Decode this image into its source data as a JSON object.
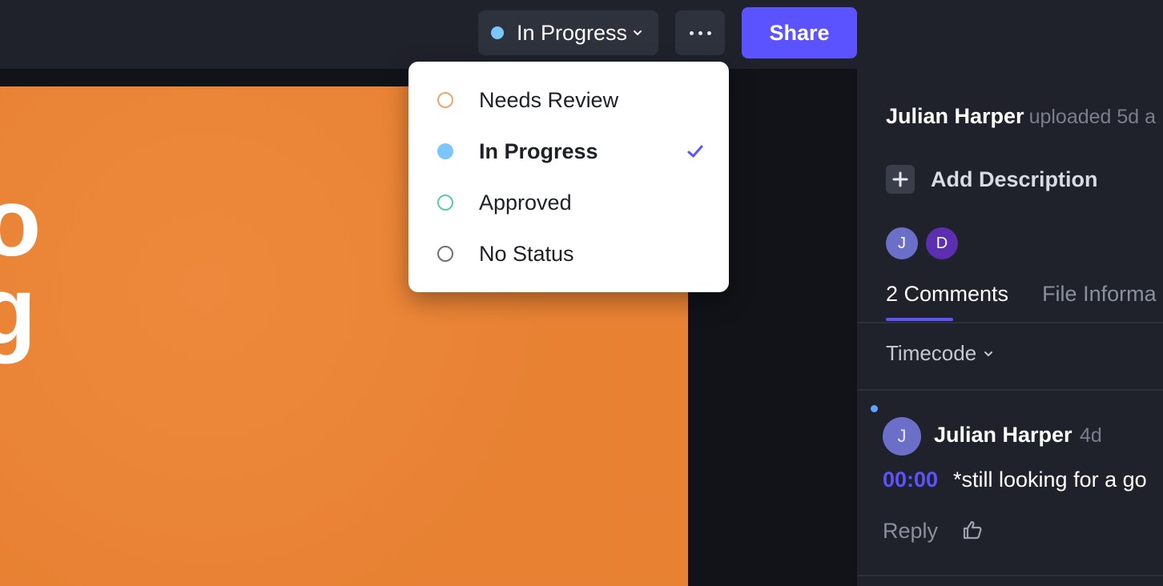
{
  "header": {
    "status": {
      "label": "In Progress",
      "color": "#7cc6fb"
    },
    "more_icon": "ellipsis-icon",
    "share_label": "Share"
  },
  "preview": {
    "background": "#ed8434",
    "visible_glyphs": [
      "o",
      "g"
    ]
  },
  "status_menu": {
    "options": [
      {
        "label": "Needs Review",
        "color": "#f0a46e",
        "style": "outline",
        "selected": false
      },
      {
        "label": "In Progress",
        "color": "#7cc6fb",
        "style": "filled",
        "selected": true
      },
      {
        "label": "Approved",
        "color": "#5cc8b0",
        "style": "outline",
        "selected": false
      },
      {
        "label": "No Status",
        "color": "#6e717a",
        "style": "outline",
        "selected": false
      }
    ],
    "check_color": "#5b53ff"
  },
  "sidebar": {
    "uploader_name": "Julian Harper",
    "uploader_meta": "uploaded 5d a",
    "add_description": "Add Description",
    "avatars": [
      "J",
      "D"
    ],
    "tabs": [
      {
        "label": "2 Comments",
        "active": true
      },
      {
        "label": "File Informa",
        "active": false
      }
    ],
    "sort_label": "Timecode",
    "comments": [
      {
        "initial": "J",
        "author": "Julian Harper",
        "time": "4d",
        "timecode": "00:00",
        "text": "*still looking for a go",
        "reply_label": "Reply"
      }
    ]
  }
}
